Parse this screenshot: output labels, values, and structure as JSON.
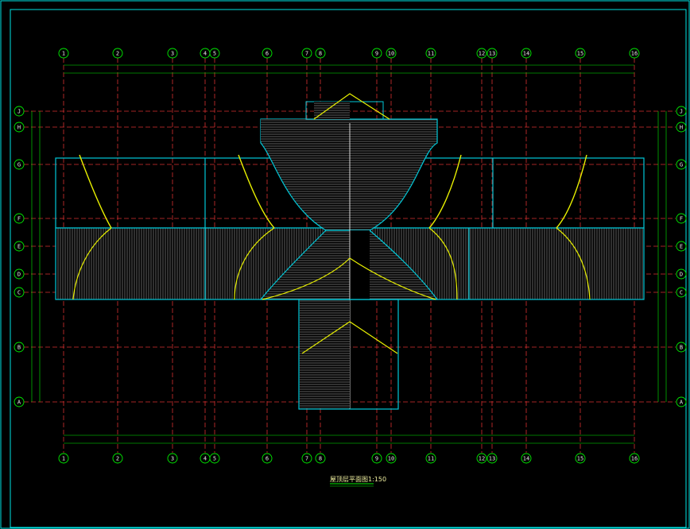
{
  "drawing": {
    "title": "屋顶层平面图1:150",
    "colors": {
      "background": "#000000",
      "frame": "#00e5e5",
      "axis_grid": "#d83030",
      "axis_bubble": "#00ee00",
      "dimension_line": "#00ee00",
      "roof_outline": "#00c8d8",
      "slope_curve": "#e8f000",
      "hatch": "#a0a0a0"
    },
    "axes_columns": [
      "1",
      "2",
      "3",
      "4",
      "5",
      "6",
      "7",
      "8",
      "9",
      "10",
      "11",
      "12",
      "13",
      "14",
      "15",
      "16"
    ],
    "axes_rows": [
      "J",
      "H",
      "G",
      "F",
      "E",
      "D",
      "C",
      "B",
      "A"
    ]
  }
}
